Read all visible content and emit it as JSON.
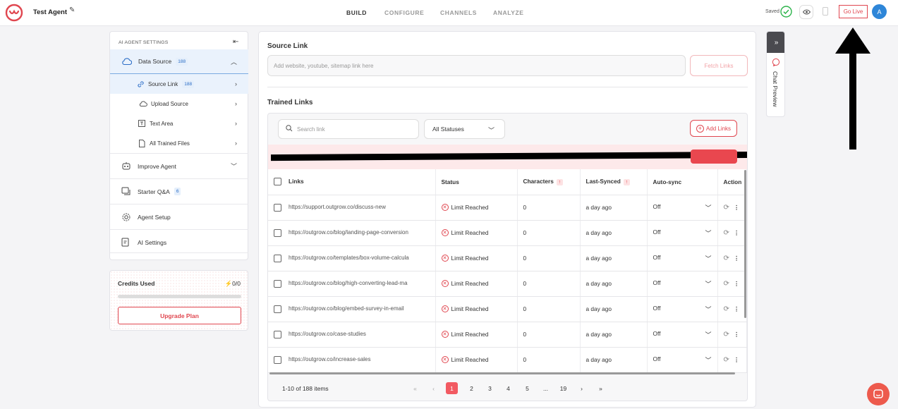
{
  "header": {
    "agent_name": "Test Agent",
    "nav": [
      "BUILD",
      "CONFIGURE",
      "CHANNELS",
      "ANALYZE"
    ],
    "active_nav": "BUILD",
    "saved_label": "Saved",
    "go_live": "Go Live",
    "avatar_initial": "A"
  },
  "sidebar": {
    "title": "AI AGENT SETTINGS",
    "items": [
      {
        "label": "Data Source",
        "badge": "188",
        "icon": "cloud-icon"
      },
      {
        "label": "Source Link",
        "badge": "188",
        "icon": "link-icon"
      },
      {
        "label": "Upload Source",
        "icon": "cloud-upload-icon"
      },
      {
        "label": "Text Area",
        "icon": "text-icon"
      },
      {
        "label": "All Trained Files",
        "icon": "file-icon"
      },
      {
        "label": "Improve Agent",
        "icon": "robot-icon"
      },
      {
        "label": "Starter Q&A",
        "badge": "6",
        "icon": "qa-icon"
      },
      {
        "label": "Agent Setup",
        "icon": "gear-icon"
      },
      {
        "label": "AI Settings",
        "icon": "ai-settings-icon"
      }
    ]
  },
  "credits": {
    "title": "Credits Used",
    "value": "0/0",
    "used_fraction": 0,
    "upgrade": "Upgrade Plan"
  },
  "source": {
    "title": "Source Link",
    "placeholder": "Add website, youtube, sitemap link here",
    "fetch": "Fetch Links"
  },
  "trained": {
    "title": "Trained Links",
    "search_placeholder": "Search link",
    "status_filter": "All Statuses",
    "add_links": "Add Links",
    "columns": [
      "Links",
      "Status",
      "Characters",
      "Last-Synced",
      "Auto-sync",
      "Action"
    ],
    "rows": [
      {
        "link": "https://support.outgrow.co/discuss-new",
        "status": "Limit Reached",
        "chars": "0",
        "synced": "a day ago",
        "auto": "Off"
      },
      {
        "link": "https://outgrow.co/blog/landing-page-conversion",
        "status": "Limit Reached",
        "chars": "0",
        "synced": "a day ago",
        "auto": "Off"
      },
      {
        "link": "https://outgrow.co/templates/box-volume-calcula",
        "status": "Limit Reached",
        "chars": "0",
        "synced": "a day ago",
        "auto": "Off"
      },
      {
        "link": "https://outgrow.co/blog/high-converting-lead-ma",
        "status": "Limit Reached",
        "chars": "0",
        "synced": "a day ago",
        "auto": "Off"
      },
      {
        "link": "https://outgrow.co/blog/embed-survey-in-email",
        "status": "Limit Reached",
        "chars": "0",
        "synced": "a day ago",
        "auto": "Off"
      },
      {
        "link": "https://outgrow.co/case-studies",
        "status": "Limit Reached",
        "chars": "0",
        "synced": "a day ago",
        "auto": "Off"
      },
      {
        "link": "https://outgrow.co/increase-sales",
        "status": "Limit Reached",
        "chars": "0",
        "synced": "a day ago",
        "auto": "Off"
      }
    ],
    "pager": {
      "count": "1-10 of 188 items",
      "pages": [
        "1",
        "2",
        "3",
        "4",
        "5",
        "...",
        "19"
      ],
      "current": "1"
    }
  },
  "chat_preview": {
    "label": "Chat Preview"
  },
  "colors": {
    "accent": "#e0464f",
    "badge_blue": "#2c6ec7"
  }
}
